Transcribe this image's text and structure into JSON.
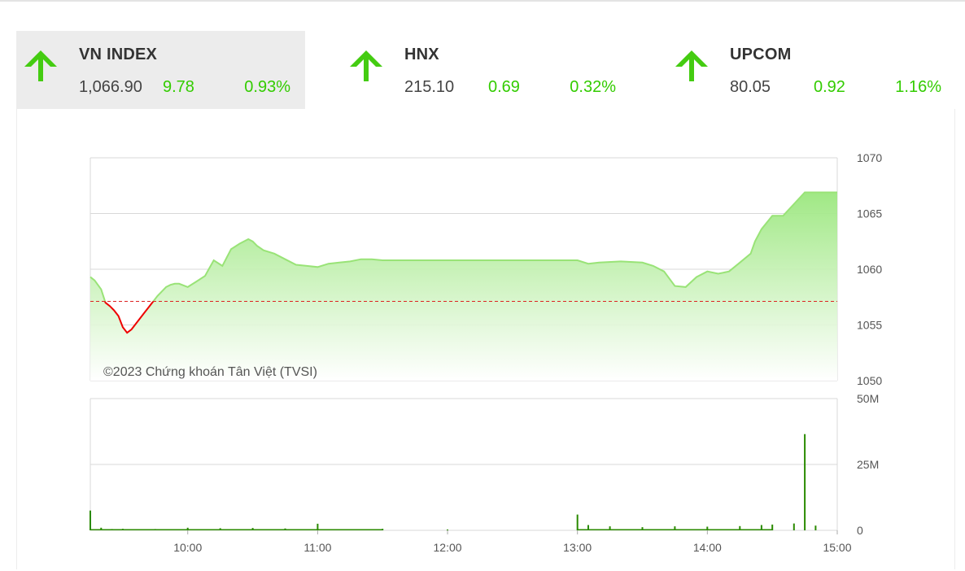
{
  "indices": [
    {
      "name": "VN INDEX",
      "value": "1,066.90",
      "change": "9.78",
      "percent": "0.93%",
      "direction": "up",
      "active": true
    },
    {
      "name": "HNX",
      "value": "215.10",
      "change": "0.69",
      "percent": "0.32%",
      "direction": "up",
      "active": false
    },
    {
      "name": "UPCOM",
      "value": "80.05",
      "change": "0.92",
      "percent": "1.16%",
      "direction": "up",
      "active": false
    }
  ],
  "colors": {
    "up": "#33cc00",
    "arrow": "#44cc11",
    "down_line": "#ee0000",
    "up_line": "#99e377",
    "area_top": "#9be77e",
    "reference": "#dd2222",
    "volume": "#2a8a00",
    "grid": "#d8d8d8"
  },
  "chart_data": [
    {
      "type": "area",
      "watermark": "©2023 Chứng khoán Tân Việt (TVSI)",
      "reference_value": 1057.12,
      "y_range": [
        1050,
        1070
      ],
      "y_ticks": [
        "1070",
        "1065",
        "1060",
        "1055",
        "1050"
      ],
      "x_range": [
        "9:15",
        "15:00"
      ],
      "x_ticks": [
        "10:00",
        "11:00",
        "12:00",
        "13:00",
        "14:00",
        "15:00"
      ],
      "grid": true,
      "axis_position": "right",
      "series": [
        {
          "x": [
            "9:15",
            "9:17",
            "9:20",
            "9:22",
            "9:24",
            "9:26",
            "9:28",
            "9:30",
            "9:32",
            "9:34",
            "9:36",
            "9:38",
            "9:40",
            "9:42",
            "9:44",
            "9:46",
            "9:48",
            "9:50",
            "9:52",
            "9:54",
            "9:56",
            "10:00",
            "10:04",
            "10:08",
            "10:12",
            "10:16",
            "10:20",
            "10:24",
            "10:28",
            "10:30",
            "10:32",
            "10:35",
            "10:40",
            "10:45",
            "10:50",
            "11:00",
            "11:05",
            "11:10",
            "11:15",
            "11:20",
            "11:25",
            "11:30",
            "11:45",
            "12:00",
            "12:30",
            "13:00",
            "13:05",
            "13:10",
            "13:20",
            "13:30",
            "13:35",
            "13:40",
            "13:45",
            "13:50",
            "13:55",
            "14:00",
            "14:05",
            "14:10",
            "14:15",
            "14:20",
            "14:22",
            "14:25",
            "14:30",
            "14:35",
            "14:45",
            "15:00"
          ],
          "y": [
            1059.3,
            1059.0,
            1058.2,
            1057.0,
            1056.7,
            1056.3,
            1055.8,
            1054.8,
            1054.3,
            1054.6,
            1055.1,
            1055.6,
            1056.1,
            1056.6,
            1057.1,
            1057.6,
            1058.0,
            1058.4,
            1058.6,
            1058.7,
            1058.7,
            1058.4,
            1058.9,
            1059.4,
            1060.8,
            1060.3,
            1061.8,
            1062.3,
            1062.7,
            1062.5,
            1062.1,
            1061.7,
            1061.4,
            1060.9,
            1060.4,
            1060.2,
            1060.5,
            1060.6,
            1060.7,
            1060.9,
            1060.9,
            1060.8,
            1060.8,
            1060.8,
            1060.8,
            1060.8,
            1060.5,
            1060.6,
            1060.7,
            1060.6,
            1060.3,
            1059.8,
            1058.5,
            1058.4,
            1059.3,
            1059.8,
            1059.6,
            1059.8,
            1060.6,
            1061.4,
            1062.5,
            1063.6,
            1064.8,
            1064.8,
            1066.9,
            1066.9
          ]
        }
      ]
    },
    {
      "type": "bar",
      "y_range": [
        0,
        50
      ],
      "y_unit": "M",
      "y_ticks": [
        "50M",
        "25M",
        "0"
      ],
      "x_range": [
        "9:15",
        "15:00"
      ],
      "x_ticks": [
        "10:00",
        "11:00",
        "12:00",
        "13:00",
        "14:00",
        "15:00"
      ],
      "grid": true,
      "series": [
        {
          "x": [
            "9:15",
            "9:20",
            "9:25",
            "9:30",
            "9:35",
            "9:45",
            "10:00",
            "10:15",
            "10:30",
            "10:45",
            "11:00",
            "11:30",
            "12:00",
            "13:00",
            "13:05",
            "13:15",
            "13:30",
            "13:45",
            "14:00",
            "14:15",
            "14:25",
            "14:30",
            "14:40",
            "14:45",
            "14:50"
          ],
          "values": [
            7.5,
            1.0,
            0.5,
            0.6,
            0.4,
            0.5,
            1.0,
            0.8,
            0.9,
            0.7,
            2.5,
            0.6,
            0.3,
            6.0,
            2.0,
            1.5,
            1.2,
            1.5,
            1.4,
            1.6,
            2.0,
            2.2,
            2.6,
            36.5,
            1.8
          ]
        }
      ]
    }
  ]
}
